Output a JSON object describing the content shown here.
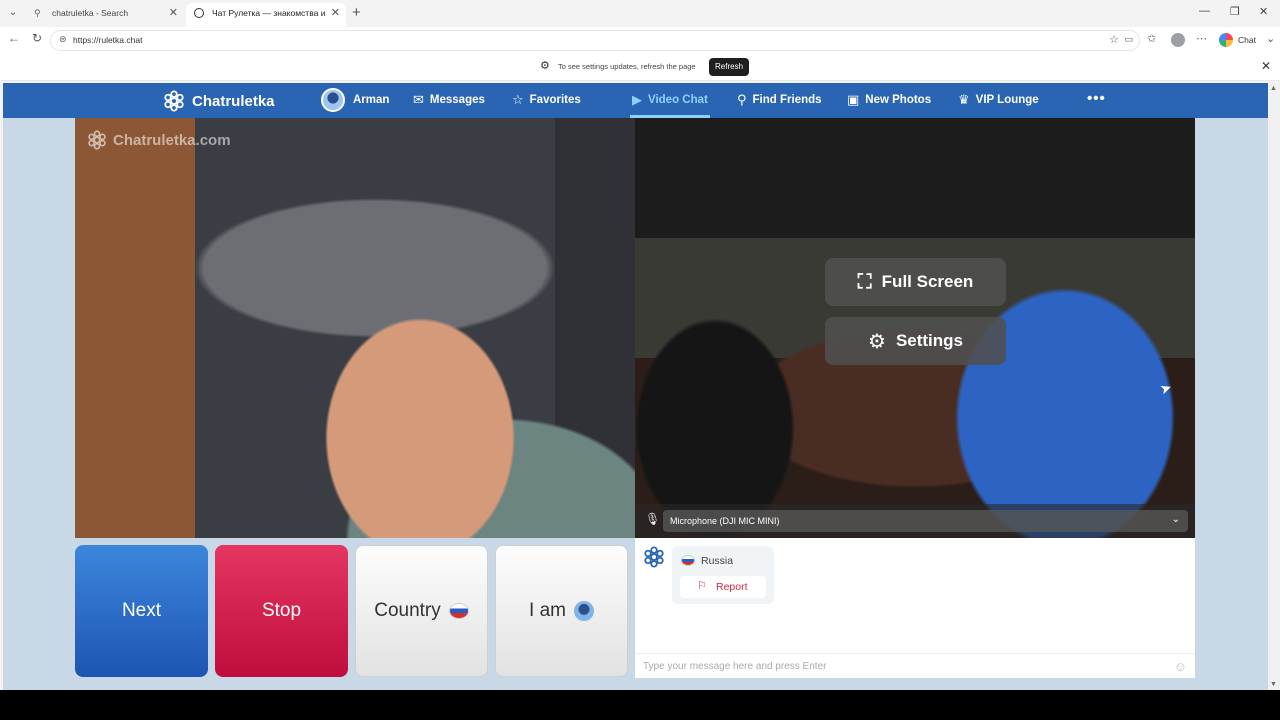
{
  "browser": {
    "tabs": [
      {
        "title": "chatruletka - Search",
        "icon": "search-icon"
      },
      {
        "title": "Чат Рулетка — знакомства и",
        "icon": "record-icon"
      }
    ],
    "url": "https://ruletka.chat",
    "chat_label": "Chat",
    "infobar": {
      "message": "To see settings updates, refresh the page",
      "refresh_label": "Refresh"
    }
  },
  "site": {
    "brand": "Chatruletka",
    "nav": [
      {
        "label": "Arman",
        "icon": "avatar-icon"
      },
      {
        "label": "Messages",
        "icon": "mail-icon"
      },
      {
        "label": "Favorites",
        "icon": "star-icon"
      },
      {
        "label": "Video Chat",
        "icon": "camera-icon",
        "active": true
      },
      {
        "label": "Find Friends",
        "icon": "search-icon"
      },
      {
        "label": "New Photos",
        "icon": "photo-icon"
      },
      {
        "label": "VIP Lounge",
        "icon": "crown-icon"
      }
    ],
    "more_label": "•••",
    "watermark": "Chatruletka.com",
    "overlay": {
      "fullscreen_label": "Full Screen",
      "settings_label": "Settings"
    },
    "microphone": "Microphone (DJI MIC MINI)",
    "actions": {
      "next": "Next",
      "stop": "Stop",
      "country": "Country",
      "iam": "I am"
    },
    "chat": {
      "country": "Russia",
      "report_label": "Report",
      "input_placeholder": "Type your message here and press Enter"
    },
    "colors": {
      "nav_bg": "#2a65b3",
      "active": "#8fd0ff",
      "next": "#2a6fcc",
      "stop": "#d41f4d",
      "page_bg": "#c8d8e6"
    }
  }
}
